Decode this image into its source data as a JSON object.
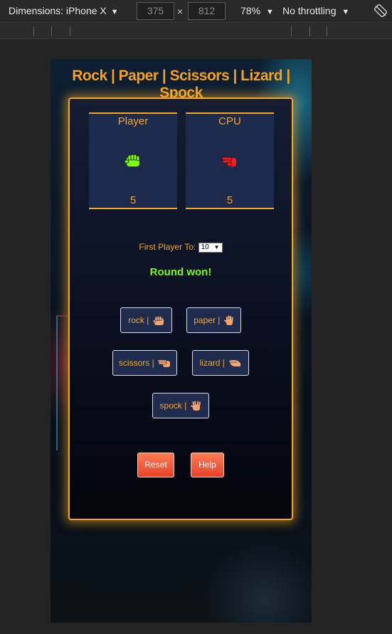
{
  "devtools": {
    "dimensions_label": "Dimensions: iPhone X",
    "width": "375",
    "height": "812",
    "zoom": "78%",
    "throttling": "No throttling"
  },
  "game": {
    "title": "Rock | Paper | Scissors | Lizard | Spock",
    "player": {
      "label": "Player",
      "score": "5",
      "hand_icon": "rock-hand-icon",
      "color": "#7cfc00"
    },
    "cpu": {
      "label": "CPU",
      "score": "5",
      "hand_icon": "scissors-hand-icon",
      "color": "#ff1a1a"
    },
    "first_to_label": "First Player To:",
    "first_to_value": "10",
    "result": "Round won!",
    "choices": {
      "rock": "rock |",
      "paper": "paper |",
      "scissors": "scissors |",
      "lizard": "lizard |",
      "spock": "spock |"
    },
    "reset_label": "Reset",
    "help_label": "Help"
  }
}
